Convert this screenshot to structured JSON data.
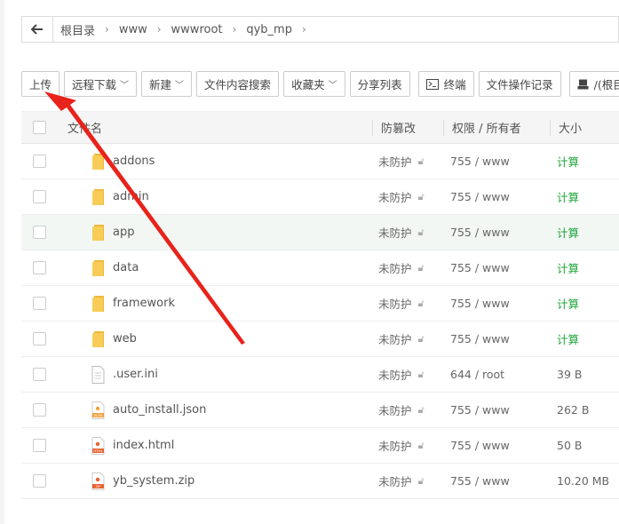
{
  "breadcrumb": {
    "back_icon": "arrow-left-icon",
    "items": [
      "根目录",
      "www",
      "wwwroot",
      "qyb_mp"
    ],
    "separator": "›"
  },
  "toolbar": {
    "upload": "上传",
    "remote_download": "远程下载",
    "new": "新建",
    "content_search": "文件内容搜索",
    "favorites": "收藏夹",
    "share_list": "分享列表",
    "terminal": "终端",
    "op_log": "文件操作记录",
    "disk": "/(根目录"
  },
  "table": {
    "headers": {
      "name": "文件名",
      "protect": "防篡改",
      "perm": "权限 / 所有者",
      "size": "大小"
    },
    "rows": [
      {
        "name": "addons",
        "type": "folder",
        "protect": "未防护",
        "perm": "755 / www",
        "size": "计算",
        "calc": true
      },
      {
        "name": "admin",
        "type": "folder",
        "protect": "未防护",
        "perm": "755 / www",
        "size": "计算",
        "calc": true
      },
      {
        "name": "app",
        "type": "folder",
        "protect": "未防护",
        "perm": "755 / www",
        "size": "计算",
        "calc": true
      },
      {
        "name": "data",
        "type": "folder",
        "protect": "未防护",
        "perm": "755 / www",
        "size": "计算",
        "calc": true
      },
      {
        "name": "framework",
        "type": "folder",
        "protect": "未防护",
        "perm": "755 / www",
        "size": "计算",
        "calc": true
      },
      {
        "name": "web",
        "type": "folder",
        "protect": "未防护",
        "perm": "755 / www",
        "size": "计算",
        "calc": true
      },
      {
        "name": ".user.ini",
        "type": "ini",
        "protect": "未防护",
        "perm": "644 / root",
        "size": "39 B",
        "calc": false
      },
      {
        "name": "auto_install.json",
        "type": "json",
        "protect": "未防护",
        "perm": "755 / www",
        "size": "262 B",
        "calc": false
      },
      {
        "name": "index.html",
        "type": "html",
        "protect": "未防护",
        "perm": "755 / www",
        "size": "50 B",
        "calc": false
      },
      {
        "name": "yb_system.zip",
        "type": "zip",
        "protect": "未防护",
        "perm": "755 / www",
        "size": "10.20 MB",
        "calc": false
      }
    ]
  },
  "colors": {
    "accent_green": "#20a53a",
    "folder_yellow": "#f5c94a",
    "arrow_red": "#e8231b"
  }
}
